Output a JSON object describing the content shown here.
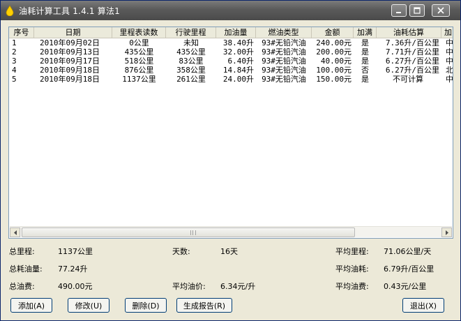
{
  "window": {
    "title": "油耗计算工具 1.4.1 算法1",
    "controls": {
      "minimize": "minimize-icon",
      "maximize": "maximize-icon",
      "close": "close-icon"
    }
  },
  "table": {
    "columns": [
      "序号",
      "日期",
      "里程表读数",
      "行驶里程",
      "加油量",
      "燃油类型",
      "金额",
      "加满",
      "油耗估算",
      "加"
    ],
    "rows": [
      [
        "1",
        "2010年09月02日",
        "0公里",
        "未知",
        "38.40升",
        "93#无铅汽油",
        "240.00元",
        "是",
        "7.36升/百公里",
        "中"
      ],
      [
        "2",
        "2010年09月13日",
        "435公里",
        "435公里",
        "32.00升",
        "93#无铅汽油",
        "200.00元",
        "是",
        "7.71升/百公里",
        "中"
      ],
      [
        "3",
        "2010年09月17日",
        "518公里",
        "83公里",
        "6.40升",
        "93#无铅汽油",
        "40.00元",
        "是",
        "6.27升/百公里",
        "中"
      ],
      [
        "4",
        "2010年09月18日",
        "876公里",
        "358公里",
        "14.84升",
        "93#无铅汽油",
        "100.00元",
        "否",
        "6.27升/百公里",
        "北"
      ],
      [
        "5",
        "2010年09月18日",
        "1137公里",
        "261公里",
        "24.00升",
        "93#无铅汽油",
        "150.00元",
        "是",
        "不可计算",
        "中"
      ]
    ]
  },
  "summary": {
    "total_mileage_label": "总里程:",
    "total_mileage_value": "1137公里",
    "days_label": "天数:",
    "days_value": "16天",
    "avg_mileage_label": "平均里程:",
    "avg_mileage_value": "71.06公里/天",
    "total_fuel_label": "总耗油量:",
    "total_fuel_value": "77.24升",
    "avg_consumption_label": "平均油耗:",
    "avg_consumption_value": "6.79升/百公里",
    "total_cost_label": "总油费:",
    "total_cost_value": "490.00元",
    "avg_price_label": "平均油价:",
    "avg_price_value": "6.34元/升",
    "avg_cost_label": "平均油费:",
    "avg_cost_value": "0.43元/公里"
  },
  "buttons": {
    "add": "添加(A)",
    "edit": "修改(U)",
    "delete": "删除(D)",
    "report": "生成报告(R)",
    "exit": "退出(X)"
  },
  "colors": {
    "frame": "#ece9d8",
    "titlebar": "#5a5a5a",
    "list_border": "#7f9db9"
  }
}
